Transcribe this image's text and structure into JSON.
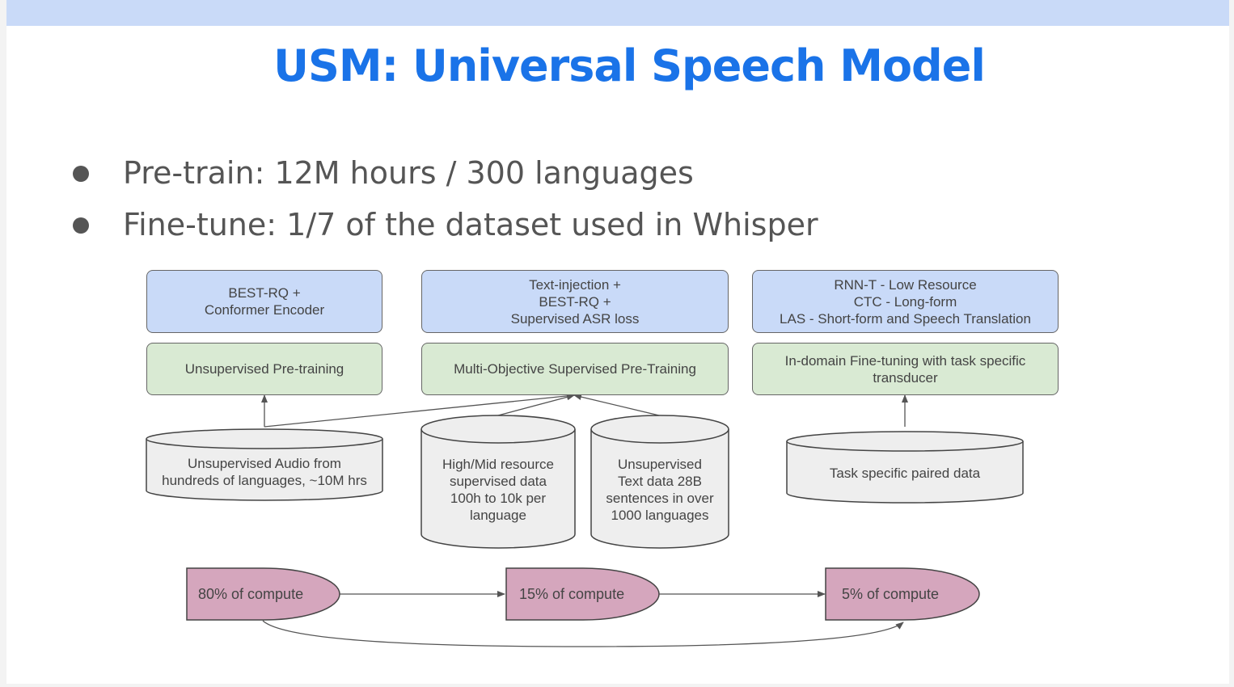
{
  "title": "USM: Universal Speech Model",
  "bullets": [
    "Pre-train: 12M hours / 300 languages",
    "Fine-tune: 1/7 of the dataset used in Whisper"
  ],
  "diagram": {
    "method_boxes": [
      "BEST-RQ +\nConformer Encoder",
      "Text-injection +\nBEST-RQ +\nSupervised ASR loss",
      "RNN-T - Low Resource\nCTC - Long-form\nLAS - Short-form and Speech Translation"
    ],
    "stage_boxes": [
      "Unsupervised Pre-training",
      "Multi-Objective Supervised Pre-Training",
      "In-domain Fine-tuning with task specific\ntransducer"
    ],
    "datasets": [
      "Unsupervised Audio from\nhundreds of languages, ~10M hrs",
      "High/Mid resource\nsupervised data\n100h to 10k per\nlanguage",
      "Unsupervised\nText data 28B\nsentences in over\n1000 languages",
      "Task specific paired data"
    ],
    "compute": [
      "80% of compute",
      "15% of compute",
      "5% of compute"
    ]
  },
  "colors": {
    "title": "#1a73e8",
    "top_bar": "#c9daf8",
    "method_box": "#c9daf8",
    "stage_box": "#d9ead3",
    "dataset": "#eeeeee",
    "compute": "#d5a6bd"
  }
}
